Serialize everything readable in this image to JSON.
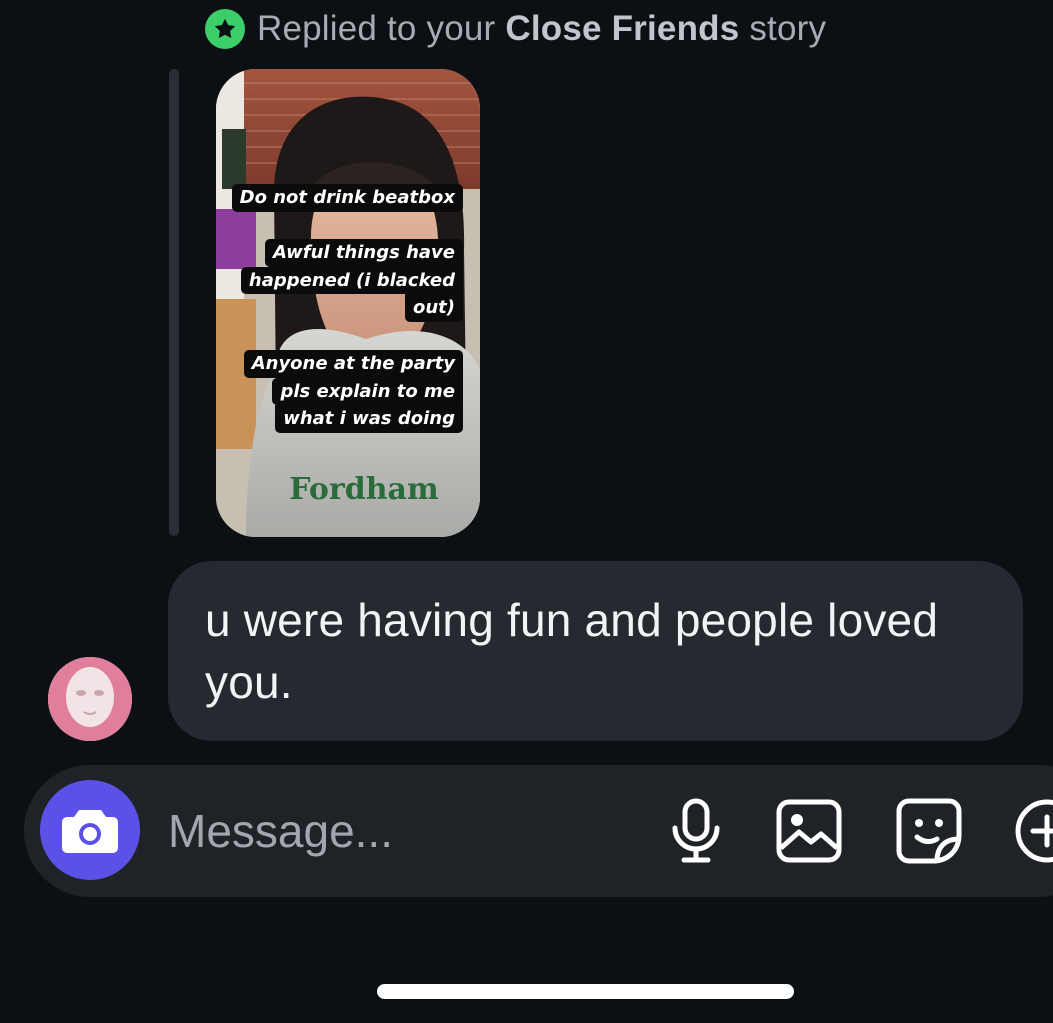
{
  "reply_header": {
    "prefix": "Replied to your ",
    "highlight": "Close Friends",
    "suffix": " story",
    "badge_icon": "star-icon",
    "badge_color": "#3bcf6a"
  },
  "story": {
    "captions": [
      [
        "Do not drink beatbox"
      ],
      [
        "Awful things have",
        "happened (i blacked",
        "out)"
      ],
      [
        "Anyone at the party",
        "pls explain to me",
        "what i was doing"
      ]
    ],
    "shirt_text": "Fordham"
  },
  "message": {
    "line1": "u were having fun and people loved",
    "line2": "you."
  },
  "composer": {
    "placeholder": "Message...",
    "camera_icon": "camera-icon",
    "tools": [
      "microphone-icon",
      "gallery-icon",
      "sticker-icon",
      "plus-icon"
    ],
    "accent_color": "#5b51e6"
  }
}
